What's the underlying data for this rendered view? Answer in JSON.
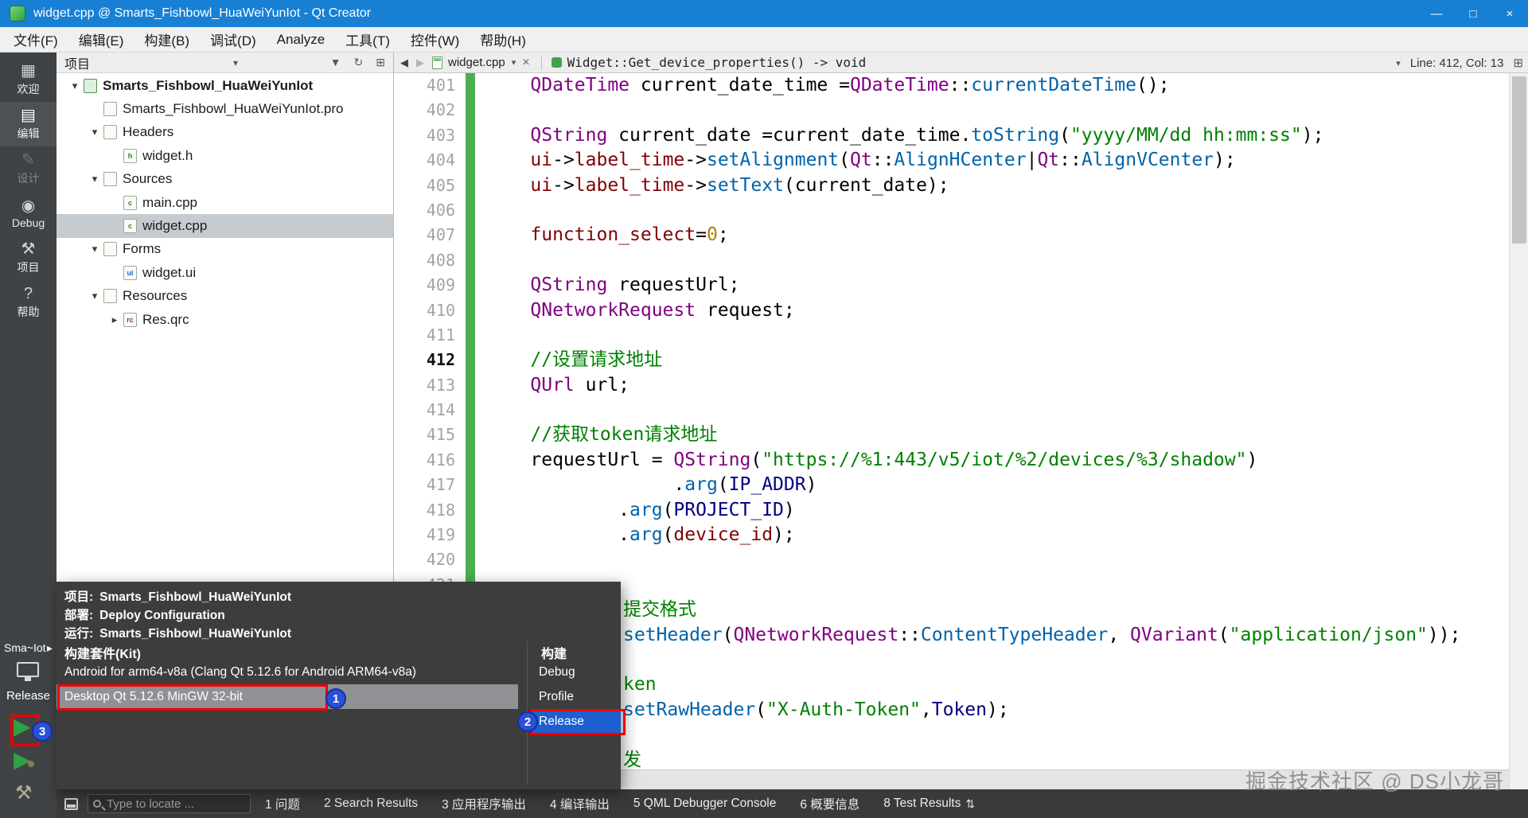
{
  "title_bar": {
    "title": "widget.cpp @ Smarts_Fishbowl_HuaWeiYunIot - Qt Creator",
    "minimize_glyph": "—",
    "maximize_glyph": "□",
    "close_glyph": "×"
  },
  "menu_bar": {
    "items": [
      "文件(F)",
      "编辑(E)",
      "构建(B)",
      "调试(D)",
      "Analyze",
      "工具(T)",
      "控件(W)",
      "帮助(H)"
    ]
  },
  "mode_bar": {
    "items": [
      {
        "key": "welcome",
        "label": "欢迎",
        "icon": "welcome-icon",
        "glyph": "▦",
        "state": "normal"
      },
      {
        "key": "edit",
        "label": "编辑",
        "icon": "edit-mode-icon",
        "glyph": "▤",
        "state": "active"
      },
      {
        "key": "design",
        "label": "设计",
        "icon": "design-mode-icon",
        "glyph": "✎",
        "state": "disabled"
      },
      {
        "key": "debug",
        "label": "Debug",
        "icon": "debug-mode-icon",
        "glyph": "◉",
        "state": "normal"
      },
      {
        "key": "projects",
        "label": "项目",
        "icon": "projects-mode-icon",
        "glyph": "⚒",
        "state": "normal"
      },
      {
        "key": "help",
        "label": "帮助",
        "icon": "help-mode-icon",
        "glyph": "?",
        "state": "normal"
      }
    ],
    "kit_button": {
      "project_short": "Sma~Iot",
      "arrow": "▸",
      "build_config": "Release"
    },
    "run_glyph": "▶",
    "debug_run_glyph": "▶",
    "build_glyph": "⚒"
  },
  "project_panel": {
    "header": "项目",
    "icons": {
      "dropdown": "▾",
      "filter": "▼",
      "sync": "↻",
      "split": "⊞"
    },
    "tree": [
      {
        "label": "Smarts_Fishbowl_HuaWeiYunIot",
        "depth": 0,
        "chevron": "▾",
        "icon": "project",
        "bold": true
      },
      {
        "label": "Smarts_Fishbowl_HuaWeiYunIot.pro",
        "depth": 1,
        "chevron": "",
        "icon": "pro"
      },
      {
        "label": "Headers",
        "depth": 1,
        "chevron": "▾",
        "icon": "folder-h"
      },
      {
        "label": "widget.h",
        "depth": 2,
        "chevron": "",
        "icon": "file-h"
      },
      {
        "label": "Sources",
        "depth": 1,
        "chevron": "▾",
        "icon": "folder-cpp"
      },
      {
        "label": "main.cpp",
        "depth": 2,
        "chevron": "",
        "icon": "file-cpp"
      },
      {
        "label": "widget.cpp",
        "depth": 2,
        "chevron": "",
        "icon": "file-cpp",
        "selected": true
      },
      {
        "label": "Forms",
        "depth": 1,
        "chevron": "▾",
        "icon": "folder-ui"
      },
      {
        "label": "widget.ui",
        "depth": 2,
        "chevron": "",
        "icon": "file-ui"
      },
      {
        "label": "Resources",
        "depth": 1,
        "chevron": "▾",
        "icon": "folder-res"
      },
      {
        "label": "Res.qrc",
        "depth": 2,
        "chevron": "▸",
        "icon": "file-qrc"
      }
    ]
  },
  "editor": {
    "nav": {
      "back_glyph": "◀",
      "forward_glyph": "▶",
      "file_name": "widget.cpp",
      "dropdown_glyph": "▾",
      "close_glyph": "×",
      "symbol": "Widget::Get_device_properties() -> void",
      "symbol_dropdown_glyph": "▾",
      "cursor_position": "Line: 412, Col: 13",
      "split_glyph": "⊞"
    },
    "code_lines": [
      {
        "n": "401",
        "segs": [
          [
            "pl",
            "    "
          ],
          [
            "ty",
            "QDateTime"
          ],
          [
            "pl",
            " current_date_time ="
          ],
          [
            "ty",
            "QDateTime"
          ],
          [
            "pl",
            "::"
          ],
          [
            "fn",
            "currentDateTime"
          ],
          [
            "pl",
            "();"
          ]
        ]
      },
      {
        "n": "402",
        "segs": []
      },
      {
        "n": "403",
        "segs": [
          [
            "pl",
            "    "
          ],
          [
            "ty",
            "QString"
          ],
          [
            "pl",
            " current_date =current_date_time."
          ],
          [
            "fn",
            "toString"
          ],
          [
            "pl",
            "("
          ],
          [
            "st",
            "\"yyyy/MM/dd hh:mm:ss\""
          ],
          [
            "pl",
            ");"
          ]
        ]
      },
      {
        "n": "404",
        "segs": [
          [
            "pl",
            "    "
          ],
          [
            "fd",
            "ui"
          ],
          [
            "pl",
            "->"
          ],
          [
            "fd",
            "label_time"
          ],
          [
            "pl",
            "->"
          ],
          [
            "fn",
            "setAlignment"
          ],
          [
            "pl",
            "("
          ],
          [
            "ty",
            "Qt"
          ],
          [
            "pl",
            "::"
          ],
          [
            "en",
            "AlignHCenter"
          ],
          [
            "pl",
            "|"
          ],
          [
            "ty",
            "Qt"
          ],
          [
            "pl",
            "::"
          ],
          [
            "en",
            "AlignVCenter"
          ],
          [
            "pl",
            ");"
          ]
        ]
      },
      {
        "n": "405",
        "segs": [
          [
            "pl",
            "    "
          ],
          [
            "fd",
            "ui"
          ],
          [
            "pl",
            "->"
          ],
          [
            "fd",
            "label_time"
          ],
          [
            "pl",
            "->"
          ],
          [
            "fn",
            "setText"
          ],
          [
            "pl",
            "(current_date);"
          ]
        ]
      },
      {
        "n": "406",
        "segs": []
      },
      {
        "n": "407",
        "segs": [
          [
            "pl",
            "    "
          ],
          [
            "fd",
            "function_select"
          ],
          [
            "pl",
            "="
          ],
          [
            "nu",
            "0"
          ],
          [
            "pl",
            ";"
          ]
        ]
      },
      {
        "n": "408",
        "segs": []
      },
      {
        "n": "409",
        "segs": [
          [
            "pl",
            "    "
          ],
          [
            "ty",
            "QString"
          ],
          [
            "pl",
            " requestUrl;"
          ]
        ]
      },
      {
        "n": "410",
        "segs": [
          [
            "pl",
            "    "
          ],
          [
            "ty",
            "QNetworkRequest"
          ],
          [
            "pl",
            " request;"
          ]
        ]
      },
      {
        "n": "411",
        "segs": []
      },
      {
        "n": "412",
        "cur": true,
        "segs": [
          [
            "pl",
            "    "
          ],
          [
            "cm",
            "//设置请求地址"
          ]
        ]
      },
      {
        "n": "413",
        "segs": [
          [
            "pl",
            "    "
          ],
          [
            "ty",
            "QUrl"
          ],
          [
            "pl",
            " url;"
          ]
        ]
      },
      {
        "n": "414",
        "segs": []
      },
      {
        "n": "415",
        "segs": [
          [
            "pl",
            "    "
          ],
          [
            "cm",
            "//获取token请求地址"
          ]
        ]
      },
      {
        "n": "416",
        "segs": [
          [
            "pl",
            "    requestUrl = "
          ],
          [
            "ty",
            "QString"
          ],
          [
            "pl",
            "("
          ],
          [
            "st",
            "\"https://%1:443/v5/iot/%2/devices/%3/shadow\""
          ],
          [
            "pl",
            ")"
          ]
        ]
      },
      {
        "n": "417",
        "segs": [
          [
            "pl",
            "                 ."
          ],
          [
            "fn",
            "arg"
          ],
          [
            "pl",
            "("
          ],
          [
            "mc",
            "IP_ADDR"
          ],
          [
            "pl",
            ")"
          ]
        ]
      },
      {
        "n": "418",
        "segs": [
          [
            "pl",
            "            ."
          ],
          [
            "fn",
            "arg"
          ],
          [
            "pl",
            "("
          ],
          [
            "mc",
            "PROJECT_ID"
          ],
          [
            "pl",
            ")"
          ]
        ]
      },
      {
        "n": "419",
        "segs": [
          [
            "pl",
            "            ."
          ],
          [
            "fn",
            "arg"
          ],
          [
            "pl",
            "("
          ],
          [
            "fd",
            "device_id"
          ],
          [
            "pl",
            ");"
          ]
        ]
      },
      {
        "n": "420",
        "segs": []
      },
      {
        "n": "421",
        "segs": []
      },
      {
        "n": "",
        "ind": 172,
        "segs": [
          [
            "cm",
            "提交格式"
          ]
        ]
      },
      {
        "n": "",
        "ind": 172,
        "segs": [
          [
            "fn",
            "setHeader"
          ],
          [
            "pl",
            "("
          ],
          [
            "ty",
            "QNetworkRequest"
          ],
          [
            "pl",
            "::"
          ],
          [
            "en",
            "ContentTypeHeader"
          ],
          [
            "pl",
            ", "
          ],
          [
            "ty",
            "QVariant"
          ],
          [
            "pl",
            "("
          ],
          [
            "st",
            "\"application/json\""
          ],
          [
            "pl",
            "));"
          ]
        ]
      },
      {
        "n": "",
        "segs": []
      },
      {
        "n": "",
        "ind": 172,
        "segs": [
          [
            "cm",
            "ken"
          ]
        ]
      },
      {
        "n": "",
        "ind": 172,
        "segs": [
          [
            "fn",
            "setRawHeader"
          ],
          [
            "pl",
            "("
          ],
          [
            "st",
            "\"X-Auth-Token\""
          ],
          [
            "pl",
            ","
          ],
          [
            "mc",
            "Token"
          ],
          [
            "pl",
            ");"
          ]
        ]
      },
      {
        "n": "",
        "segs": []
      },
      {
        "n": "",
        "ind": 172,
        "segs": [
          [
            "cm",
            "发"
          ]
        ]
      }
    ]
  },
  "kit_popup": {
    "info": [
      {
        "label": "项目:",
        "value": "Smarts_Fishbowl_HuaWeiYunIot"
      },
      {
        "label": "部署:",
        "value": "Deploy Configuration"
      },
      {
        "label": "运行:",
        "value": "Smarts_Fishbowl_HuaWeiYunIot"
      }
    ],
    "kit_header": "构建套件(Kit)",
    "build_header": "构建",
    "kits": [
      {
        "label": "Android for arm64-v8a (Clang Qt 5.12.6 for Android ARM64-v8a)",
        "selected": false
      },
      {
        "label": "Desktop Qt 5.12.6 MinGW 32-bit",
        "selected": true
      }
    ],
    "builds": [
      {
        "label": "Debug",
        "selected": false
      },
      {
        "label": "Profile",
        "selected": false
      },
      {
        "label": "Release",
        "selected": true
      }
    ]
  },
  "annotations": {
    "step1": "1",
    "step2": "2",
    "step3": "3"
  },
  "status_bar": {
    "locator_placeholder": "Type to locate ...",
    "panes": [
      "1 问题",
      "2 Search Results",
      "3 应用程序输出",
      "4 编译输出",
      "5 QML Debugger Console",
      "6 概要信息",
      "8 Test Results"
    ],
    "panes_toggle_glyph": "⇅"
  },
  "watermark": "掘金技术社区 @ DS小龙哥",
  "colors": {
    "titlebar": "#1780d4",
    "selection_blue": "#1e5fd0",
    "annotation_red": "#ee0000",
    "change_bar_green": "#4caf50",
    "mode_bar_bg": "#404345"
  }
}
